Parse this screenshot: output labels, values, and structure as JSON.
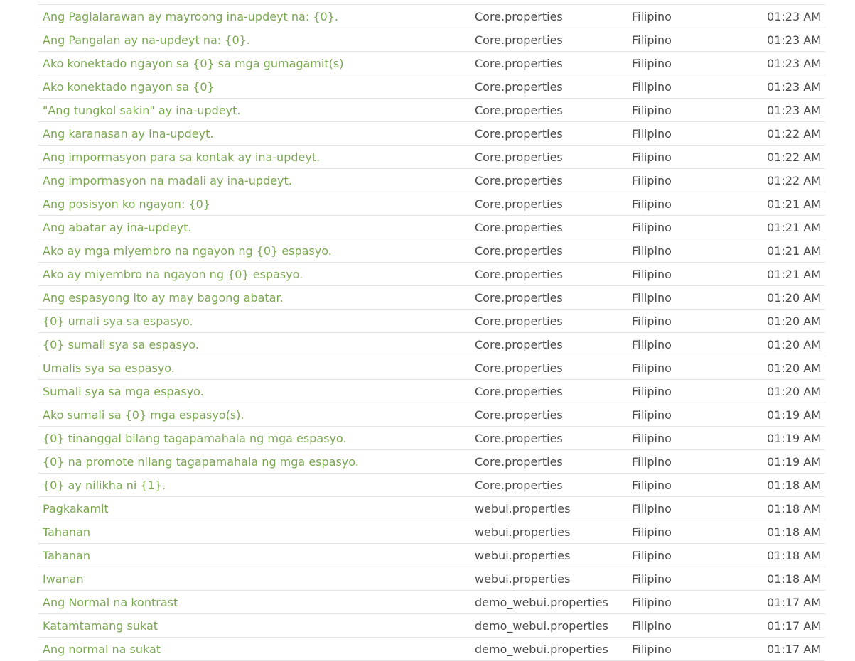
{
  "activity": {
    "rows": [
      {
        "text": "Ang Paglalarawan ay mayroong ina-updeyt na: {0}.",
        "file": "Core.properties",
        "language": "Filipino",
        "time": "01:23 AM"
      },
      {
        "text": "Ang Pangalan ay na-updeyt na: {0}.",
        "file": "Core.properties",
        "language": "Filipino",
        "time": "01:23 AM"
      },
      {
        "text": "Ako konektado ngayon sa {0} sa mga gumagamit(s)",
        "file": "Core.properties",
        "language": "Filipino",
        "time": "01:23 AM"
      },
      {
        "text": "Ako konektado ngayon sa {0}",
        "file": "Core.properties",
        "language": "Filipino",
        "time": "01:23 AM"
      },
      {
        "text": "\"Ang tungkol sakin\" ay ina-updeyt.",
        "file": "Core.properties",
        "language": "Filipino",
        "time": "01:23 AM"
      },
      {
        "text": "Ang karanasan ay ina-updeyt.",
        "file": "Core.properties",
        "language": "Filipino",
        "time": "01:22 AM"
      },
      {
        "text": "Ang impormasyon para sa kontak ay ina-updeyt.",
        "file": "Core.properties",
        "language": "Filipino",
        "time": "01:22 AM"
      },
      {
        "text": "Ang impormasyon na madali ay ina-updeyt.",
        "file": "Core.properties",
        "language": "Filipino",
        "time": "01:22 AM"
      },
      {
        "text": "Ang posisyon ko ngayon: {0}",
        "file": "Core.properties",
        "language": "Filipino",
        "time": "01:21 AM"
      },
      {
        "text": "Ang abatar ay ina-updeyt.",
        "file": "Core.properties",
        "language": "Filipino",
        "time": "01:21 AM"
      },
      {
        "text": "Ako ay mga miyembro na ngayon ng {0} espasyo.",
        "file": "Core.properties",
        "language": "Filipino",
        "time": "01:21 AM"
      },
      {
        "text": "Ako ay miyembro na ngayon ng {0} espasyo.",
        "file": "Core.properties",
        "language": "Filipino",
        "time": "01:21 AM"
      },
      {
        "text": "Ang espasyong ito ay may bagong abatar.",
        "file": "Core.properties",
        "language": "Filipino",
        "time": "01:20 AM"
      },
      {
        "text": "{0} umali sya sa espasyo.",
        "file": "Core.properties",
        "language": "Filipino",
        "time": "01:20 AM"
      },
      {
        "text": "{0} sumali sya sa espasyo.",
        "file": "Core.properties",
        "language": "Filipino",
        "time": "01:20 AM"
      },
      {
        "text": "Umalis sya sa espasyo.",
        "file": "Core.properties",
        "language": "Filipino",
        "time": "01:20 AM"
      },
      {
        "text": "Sumali sya sa mga espasyo.",
        "file": "Core.properties",
        "language": "Filipino",
        "time": "01:20 AM"
      },
      {
        "text": "Ako sumali sa {0} mga espasyo(s).",
        "file": "Core.properties",
        "language": "Filipino",
        "time": "01:19 AM"
      },
      {
        "text": "{0} tinanggal bilang tagapamahala ng mga espasyo.",
        "file": "Core.properties",
        "language": "Filipino",
        "time": "01:19 AM"
      },
      {
        "text": "{0} na promote nilang tagapamahala ng mga espasyo.",
        "file": "Core.properties",
        "language": "Filipino",
        "time": "01:19 AM"
      },
      {
        "text": "{0} ay nilikha ni {1}.",
        "file": "Core.properties",
        "language": "Filipino",
        "time": "01:18 AM"
      },
      {
        "text": "Pagkakamit",
        "file": "webui.properties",
        "language": "Filipino",
        "time": "01:18 AM"
      },
      {
        "text": "Tahanan",
        "file": "webui.properties",
        "language": "Filipino",
        "time": "01:18 AM"
      },
      {
        "text": "Tahanan",
        "file": "webui.properties",
        "language": "Filipino",
        "time": "01:18 AM"
      },
      {
        "text": "Iwanan",
        "file": "webui.properties",
        "language": "Filipino",
        "time": "01:18 AM"
      },
      {
        "text": "Ang Normal na kontrast",
        "file": "demo_webui.properties",
        "language": "Filipino",
        "time": "01:17 AM"
      },
      {
        "text": "Katamtamang sukat",
        "file": "demo_webui.properties",
        "language": "Filipino",
        "time": "01:17 AM"
      },
      {
        "text": "Ang normal na sukat",
        "file": "demo_webui.properties",
        "language": "Filipino",
        "time": "01:17 AM"
      }
    ]
  }
}
